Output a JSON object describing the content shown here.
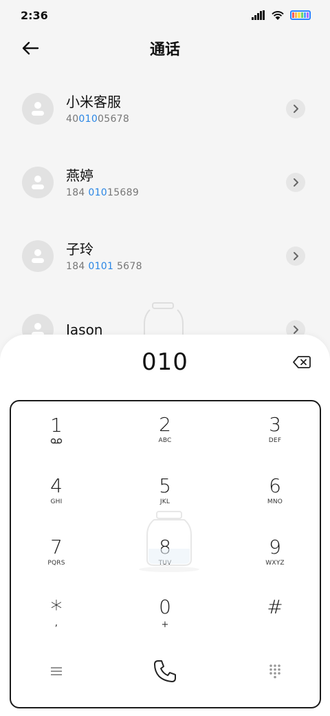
{
  "status_bar": {
    "time": "2:36"
  },
  "header": {
    "title": "通话"
  },
  "contacts": [
    {
      "name": "小米客服",
      "number_pre": "40",
      "number_hl": "010",
      "number_post": "05678"
    },
    {
      "name": "燕婷",
      "number_pre": "184 ",
      "number_hl": "010",
      "number_post": "15689"
    },
    {
      "name": "子玲",
      "number_pre": "184 ",
      "number_hl": "0101",
      "number_post": " 5678"
    },
    {
      "name": "Jason",
      "number_pre": "",
      "number_hl": "",
      "number_post": ""
    }
  ],
  "dialer": {
    "display": "010",
    "keys": [
      {
        "digit": "1",
        "letters": "voicemail"
      },
      {
        "digit": "2",
        "letters": "ABC"
      },
      {
        "digit": "3",
        "letters": "DEF"
      },
      {
        "digit": "4",
        "letters": "GHI"
      },
      {
        "digit": "5",
        "letters": "JKL"
      },
      {
        "digit": "6",
        "letters": "MNO"
      },
      {
        "digit": "7",
        "letters": "PQRS"
      },
      {
        "digit": "8",
        "letters": "TUV"
      },
      {
        "digit": "9",
        "letters": "WXYZ"
      },
      {
        "digit": "*",
        "letters": ","
      },
      {
        "digit": "0",
        "letters": "+"
      },
      {
        "digit": "#",
        "letters": ""
      }
    ]
  },
  "colors": {
    "accent": "#2a86e5",
    "battery": "#2b84ff"
  }
}
